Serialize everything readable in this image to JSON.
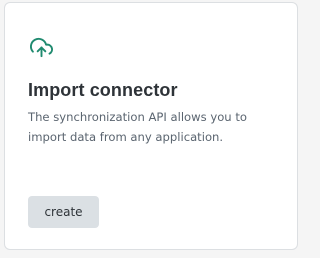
{
  "card": {
    "icon": "cloud-upload-icon",
    "accent_color": "#1f8a6f",
    "title": "Import connector",
    "description": "The synchronization API allows you to import data from any application.",
    "button_label": "create"
  }
}
